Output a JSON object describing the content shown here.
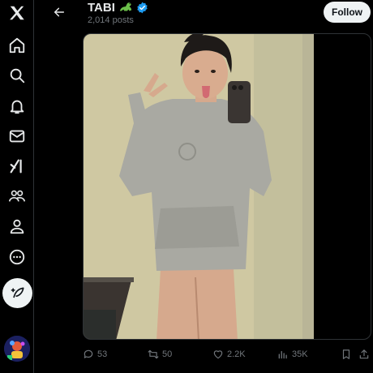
{
  "profile": {
    "name": "TABI",
    "posts_count": "2,014 posts",
    "follow_label": "Follow"
  },
  "nav": {
    "items": [
      {
        "icon": "x-logo-icon"
      },
      {
        "icon": "home-icon"
      },
      {
        "icon": "search-icon"
      },
      {
        "icon": "notifications-icon"
      },
      {
        "icon": "messages-icon"
      },
      {
        "icon": "grok-icon"
      },
      {
        "icon": "communities-icon"
      },
      {
        "icon": "profile-icon"
      },
      {
        "icon": "more-icon"
      }
    ],
    "compose_icon": "compose-icon"
  },
  "post": {
    "replies": "53",
    "reposts": "50",
    "likes": "2.2K",
    "views": "35K"
  },
  "colors": {
    "background": "#000000",
    "text": "#e7e9ea",
    "muted": "#71767b",
    "verified": "#1d9bf0",
    "follow_bg": "#eff3f4"
  }
}
